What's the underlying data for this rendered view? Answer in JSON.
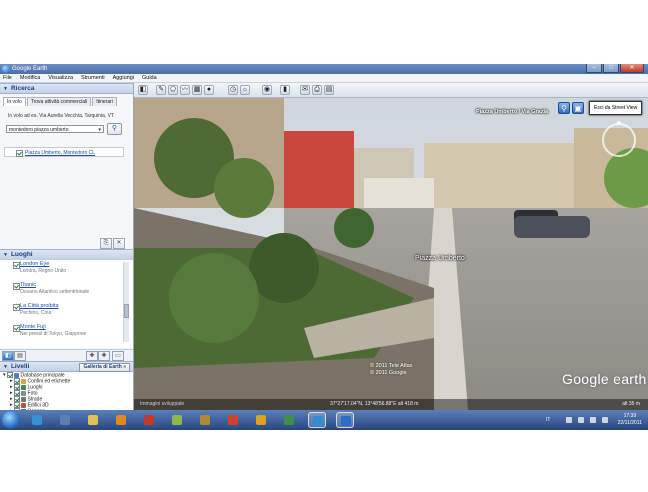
{
  "window": {
    "title": "Google Earth",
    "controls": [
      "–",
      "□",
      "✕"
    ]
  },
  "menu": [
    "File",
    "Modifica",
    "Visualizza",
    "Strumenti",
    "Aggiungi",
    "Guida"
  ],
  "search": {
    "header": "Ricerca",
    "tabs": [
      "In volo",
      "Trova attività commerciali",
      "Itinerari"
    ],
    "hint": "In volo ad es. Via Aurelia Vecchia, Tarquinia, VT",
    "query": "montedoro piazza umberto",
    "result": "Piazza Umberto, Montedoro CL"
  },
  "places": {
    "header": "Luoghi",
    "items": [
      {
        "name": "London Eye",
        "desc": "Londra, Regno Unito"
      },
      {
        "name": "Titanic",
        "desc": "Oceano Atlantico settentrionale"
      },
      {
        "name": "La Città proibita",
        "desc": "Pechino, Cina"
      },
      {
        "name": "Monte Fuji",
        "desc": "Nei pressi di Tokyo, Giappone"
      }
    ]
  },
  "layers": {
    "header": "Livelli",
    "gallery_button": "Galleria di Earth »",
    "items": [
      {
        "label": "Database principale",
        "color": "#5a7fb0"
      },
      {
        "label": "Confini ed etichette",
        "color": "#d9a441"
      },
      {
        "label": "Luoghi",
        "color": "#3f8f4a"
      },
      {
        "label": "Foto",
        "color": "#8a8a8a"
      },
      {
        "label": "Strade",
        "color": "#777777"
      },
      {
        "label": "Edifici 3D",
        "color": "#b05a3a"
      },
      {
        "label": "Oceano",
        "color": "#2f6bc2"
      },
      {
        "label": "Tempo meteorologico",
        "color": "#e0a020"
      },
      {
        "label": "Galleria",
        "color": "#c0392b"
      },
      {
        "label": "Consapevolezza globale",
        "color": "#3a8fd0"
      },
      {
        "label": "Altro",
        "color": "#e0c050"
      }
    ]
  },
  "view": {
    "location": "Piazza Umberto / Via Grazia",
    "exit_button": "Esci da Street View",
    "street_label": "Piazza Umberto",
    "copyright_lines": [
      "© 2011 Tele Atlas",
      "© 2011 Google"
    ],
    "logo": "Google earth",
    "coords": "37°27'17.04\"N, 13°48'56.88\"E alt 418 m",
    "eye_alt": "alt 35 m",
    "sponsor": "Immagini sviluppate"
  },
  "tray": {
    "lang": "IT",
    "time": "17:39",
    "date": "22/11/2011"
  }
}
